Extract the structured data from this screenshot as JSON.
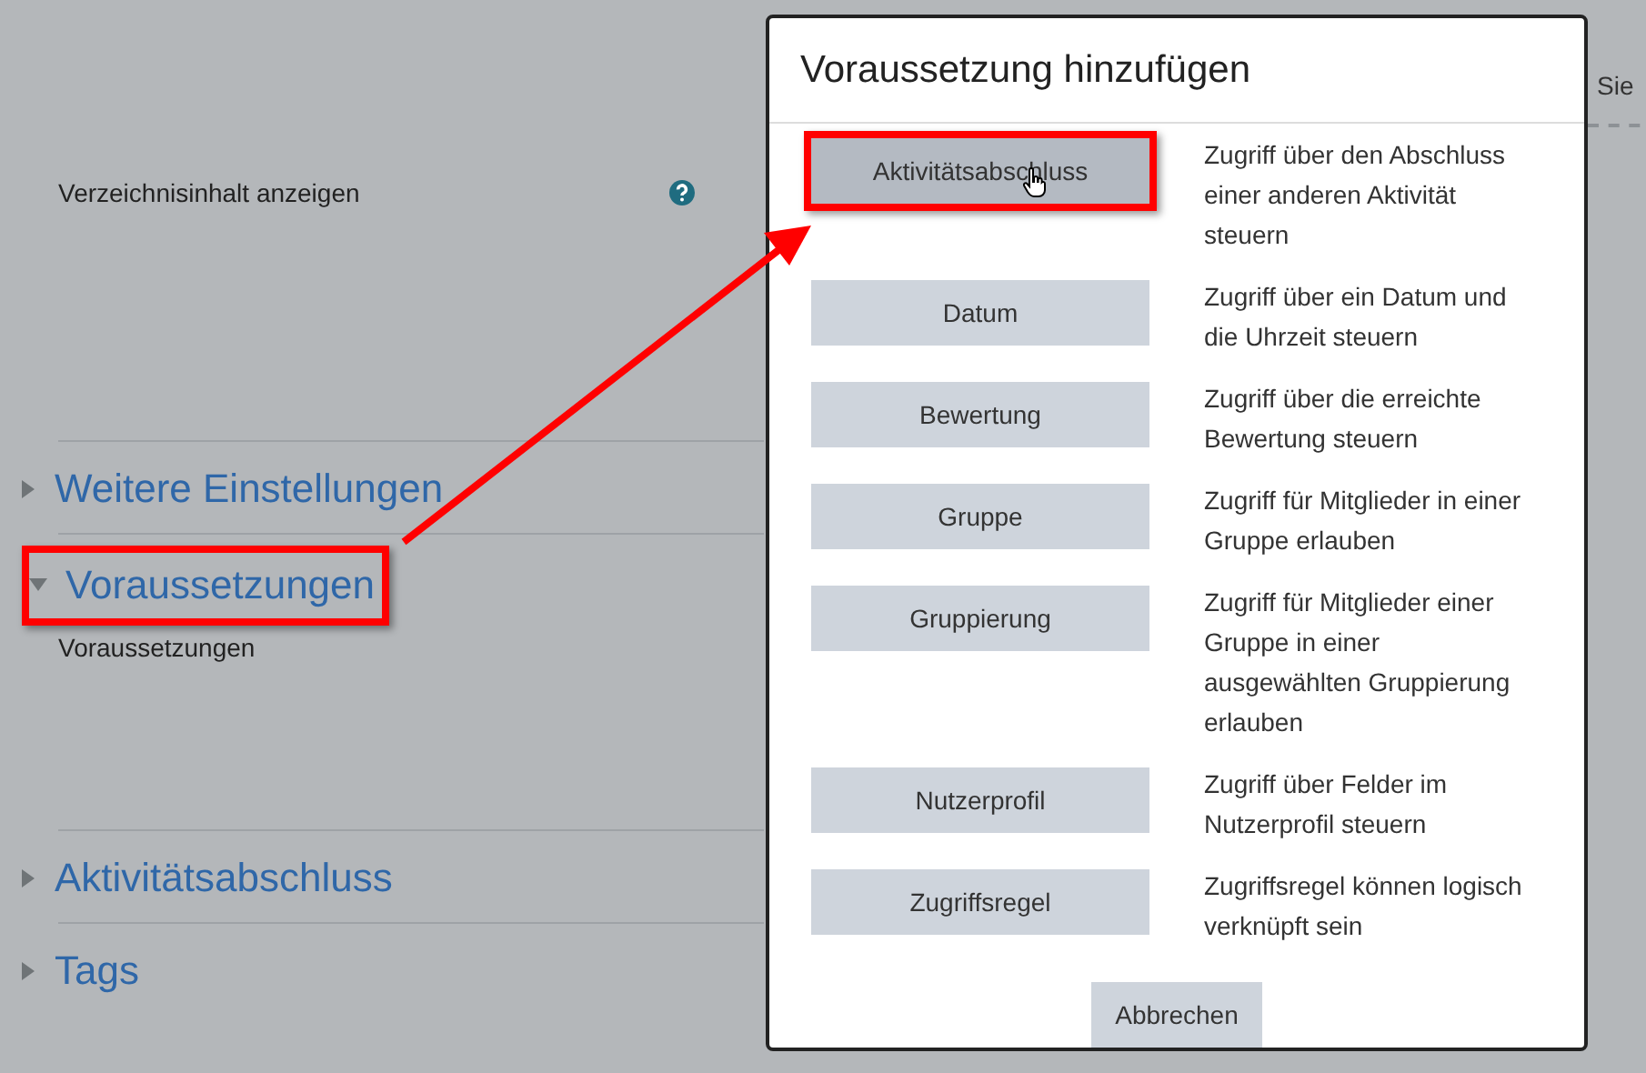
{
  "page": {
    "setting": {
      "label": "Verzeichnisinhalt anzeigen"
    },
    "sections": [
      {
        "title": "Weitere Einstellungen",
        "expanded": false,
        "highlighted": false
      },
      {
        "title": "Voraussetzungen",
        "expanded": true,
        "highlighted": true,
        "content": "Voraussetzungen"
      },
      {
        "title": "Aktivitätsabschluss",
        "expanded": false,
        "highlighted": false
      },
      {
        "title": "Tags",
        "expanded": false,
        "highlighted": false
      }
    ],
    "edge_text": "Sie"
  },
  "dialog": {
    "title": "Voraussetzung hinzufügen",
    "options": [
      {
        "label": "Aktivitätsabschluss",
        "description": "Zugriff über den Abschluss einer anderen Aktivität steuern",
        "hovered": true,
        "highlighted": true
      },
      {
        "label": "Datum",
        "description": "Zugriff über ein Datum und die Uhrzeit steuern",
        "hovered": false,
        "highlighted": false
      },
      {
        "label": "Bewertung",
        "description": "Zugriff über die erreichte Bewertung steuern",
        "hovered": false,
        "highlighted": false
      },
      {
        "label": "Gruppe",
        "description": "Zugriff für Mitglieder in einer Gruppe erlauben",
        "hovered": false,
        "highlighted": false
      },
      {
        "label": "Gruppierung",
        "description": "Zugriff für Mitglieder einer Gruppe in einer ausgewählten Gruppierung erlauben",
        "hovered": false,
        "highlighted": false
      },
      {
        "label": "Nutzerprofil",
        "description": "Zugriff über Felder im Nutzerprofil steuern",
        "hovered": false,
        "highlighted": false
      },
      {
        "label": "Zugriffsregel",
        "description": "Zugriffsregel können logisch verknüpft sein",
        "hovered": false,
        "highlighted": false
      }
    ],
    "cancel": "Abbrechen"
  }
}
